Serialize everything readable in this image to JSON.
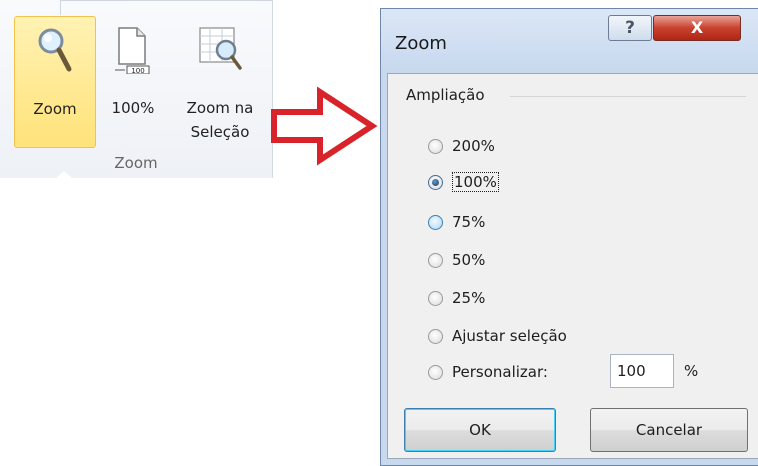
{
  "ribbon": {
    "buttons": {
      "zoom": "Zoom",
      "hundred": "100%",
      "zoom_selection_line1": "Zoom na",
      "zoom_selection_line2": "Seleção",
      "page_icon_label": "100"
    },
    "group_label": "Zoom"
  },
  "dialog": {
    "title": "Zoom",
    "help_glyph": "?",
    "close_glyph": "X",
    "group_label": "Ampliação",
    "options": [
      {
        "label": "200%",
        "checked": false
      },
      {
        "label": "100%",
        "checked": true
      },
      {
        "label": "75%",
        "checked": false
      },
      {
        "label": "50%",
        "checked": false
      },
      {
        "label": "25%",
        "checked": false
      },
      {
        "label": "Ajustar seleção",
        "checked": false
      },
      {
        "label": "Personalizar:",
        "checked": false
      }
    ],
    "custom_value": "100",
    "percent_sign": "%",
    "ok_label": "OK",
    "cancel_label": "Cancelar"
  },
  "colors": {
    "arrow": "#d9232b",
    "selected_ribbon_button": "#ffe27a",
    "dialog_frame": "#c8d9ee",
    "close_button": "#c8412f"
  },
  "icons": [
    "magnifier-icon",
    "page-100-icon",
    "zoom-selection-icon",
    "arrow-right-icon",
    "help-icon",
    "close-icon"
  ]
}
